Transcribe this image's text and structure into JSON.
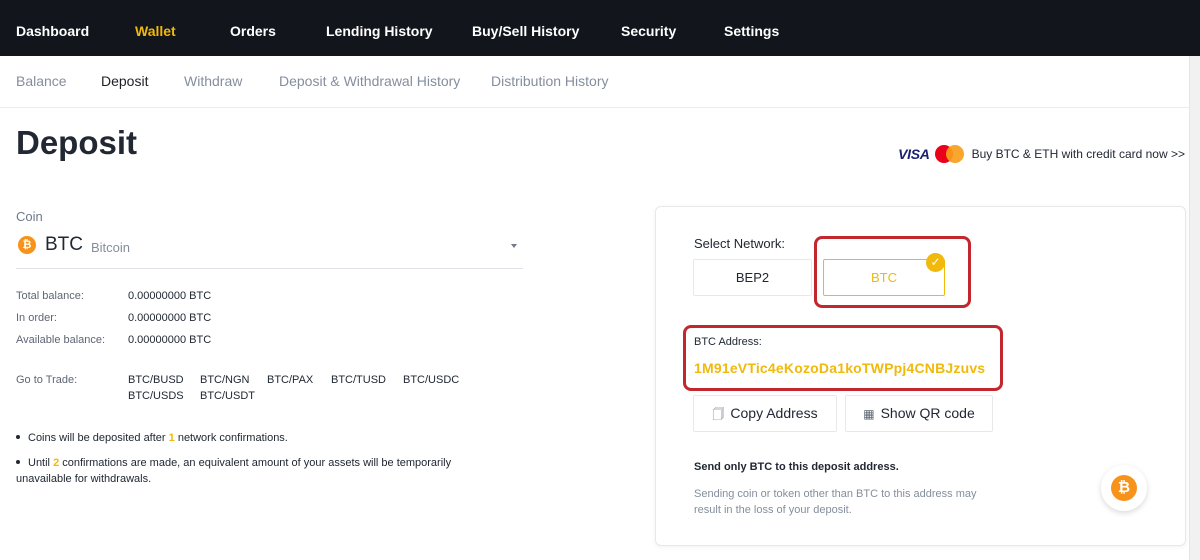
{
  "topnav": {
    "items": [
      "Dashboard",
      "Wallet",
      "Orders",
      "Lending History",
      "Buy/Sell History",
      "Security",
      "Settings"
    ],
    "active": "Wallet"
  },
  "subnav": {
    "items": [
      "Balance",
      "Deposit",
      "Withdraw",
      "Deposit & Withdrawal History",
      "Distribution History"
    ],
    "active": "Deposit"
  },
  "page_title": "Deposit",
  "promo": {
    "visa": "VISA",
    "mastercard": "MasterCard",
    "text": "Buy BTC & ETH with credit card now >>"
  },
  "coin": {
    "label": "Coin",
    "icon": "bitcoin-icon",
    "icon_glyph": "₿",
    "code": "BTC",
    "name": "Bitcoin"
  },
  "balances": [
    {
      "label": "Total balance:",
      "value": "0.00000000 BTC"
    },
    {
      "label": "In order:",
      "value": "0.00000000 BTC"
    },
    {
      "label": "Available balance:",
      "value": "0.00000000 BTC"
    }
  ],
  "trade": {
    "label": "Go to Trade:",
    "pairs": [
      "BTC/BUSD",
      "BTC/NGN",
      "BTC/PAX",
      "BTC/TUSD",
      "BTC/USDC",
      "BTC/USDS",
      "BTC/USDT"
    ]
  },
  "notes": {
    "n1_pre": "Coins will be deposited after ",
    "n1_num": "1",
    "n1_post": " network confirmations.",
    "n2_pre": "Until ",
    "n2_num": "2",
    "n2_post": " confirmations are made, an equivalent amount of your assets will be temporarily",
    "n2_line2": "unavailable for withdrawals."
  },
  "deposit_card": {
    "network_label": "Select Network:",
    "networks": [
      "BEP2",
      "BTC"
    ],
    "selected_network": "BTC",
    "check_glyph": "✓",
    "address_label": "BTC Address:",
    "address": "1M91eVTic4eKozoDa1koTWPpj4CNBJzuvs",
    "copy_label": "Copy Address",
    "qr_label": "Show QR code",
    "warn_title": "Send only BTC to this deposit address.",
    "warn_text": "Sending coin or token other than BTC to this address may result in the loss of your deposit."
  },
  "colors": {
    "accent": "#f0b90b",
    "nav_bg": "#12161c",
    "highlight_border": "#c1272d",
    "bitcoin": "#f7931a"
  }
}
